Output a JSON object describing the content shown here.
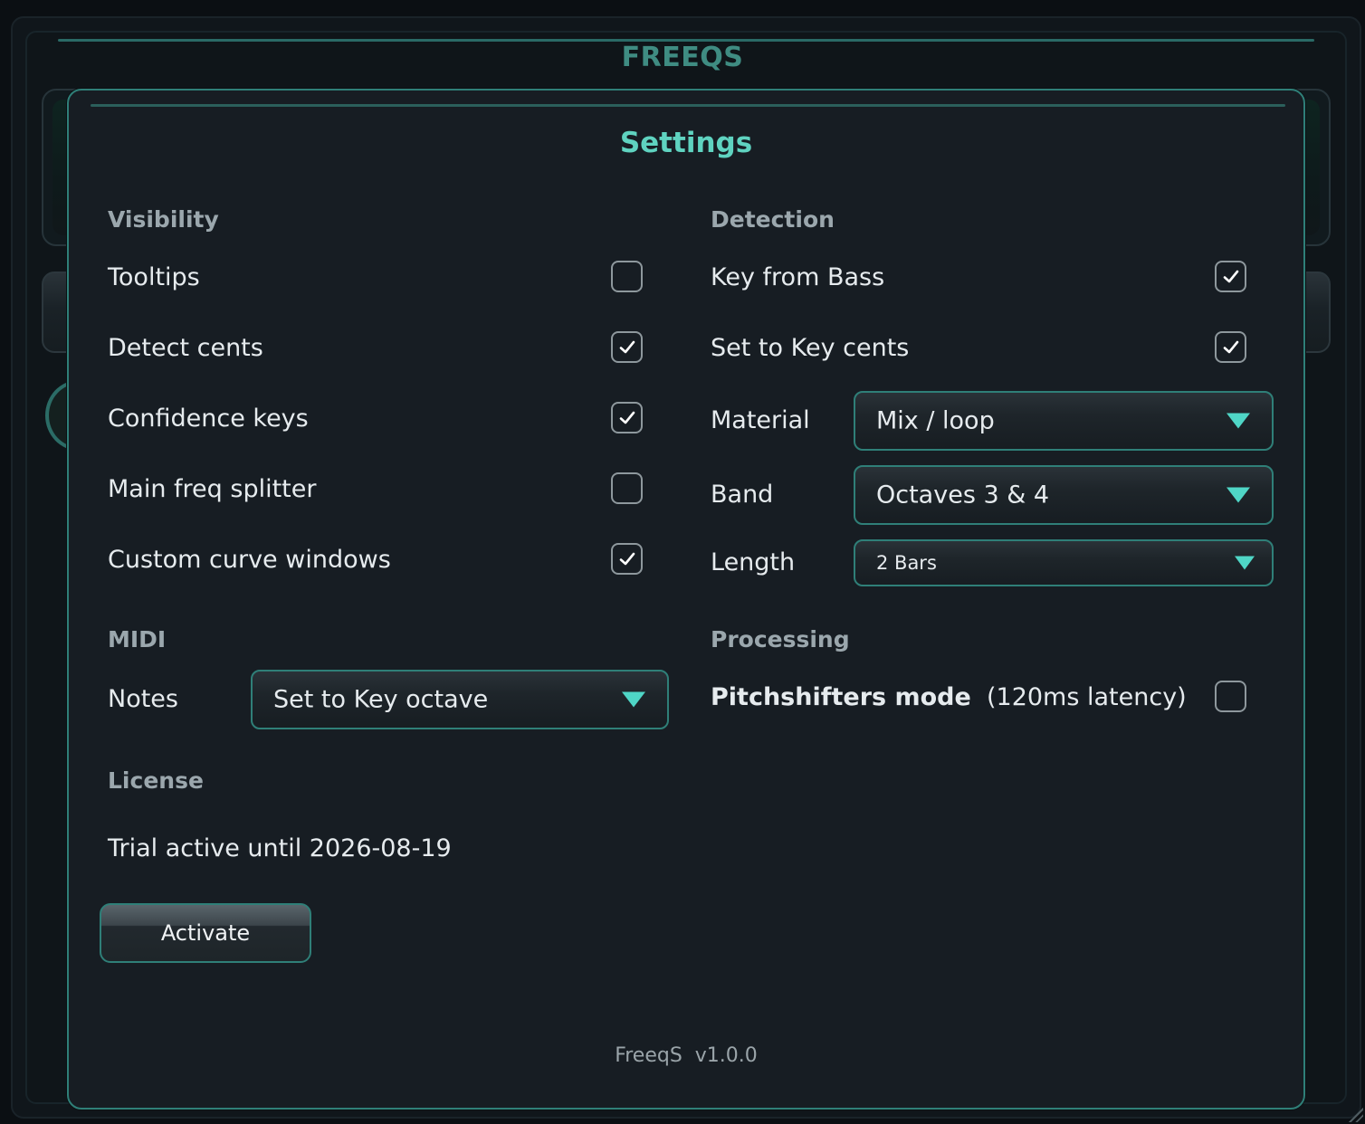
{
  "app": {
    "title": "FREEQS"
  },
  "settings": {
    "title": "Settings",
    "visibility": {
      "heading": "Visibility",
      "items": [
        {
          "label": "Tooltips",
          "checked": false
        },
        {
          "label": "Detect cents",
          "checked": true
        },
        {
          "label": "Confidence keys",
          "checked": true
        },
        {
          "label": "Main freq splitter",
          "checked": false
        },
        {
          "label": "Custom curve windows",
          "checked": true
        }
      ]
    },
    "detection": {
      "heading": "Detection",
      "key_from_bass": {
        "label": "Key from Bass",
        "checked": true
      },
      "set_to_key_cents": {
        "label": "Set to Key cents",
        "checked": true
      },
      "material": {
        "label": "Material",
        "value": "Mix / loop"
      },
      "band": {
        "label": "Band",
        "value": "Octaves 3 & 4"
      },
      "length": {
        "label": "Length",
        "value": "2 Bars"
      }
    },
    "midi": {
      "heading": "MIDI",
      "notes": {
        "label": "Notes",
        "value": "Set to Key octave"
      }
    },
    "processing": {
      "heading": "Processing",
      "pitchshifters": {
        "label": "Pitchshifters mode",
        "note": "(120ms latency)",
        "checked": false
      }
    },
    "license": {
      "heading": "License",
      "status": "Trial active until 2026-08-19",
      "activate_label": "Activate"
    },
    "footer": "FreeqS  v1.0.0"
  },
  "colors": {
    "accent": "#5fd3c0",
    "border": "#2f7f78",
    "arrow": "#4fd6c6",
    "background": "#171d23"
  }
}
